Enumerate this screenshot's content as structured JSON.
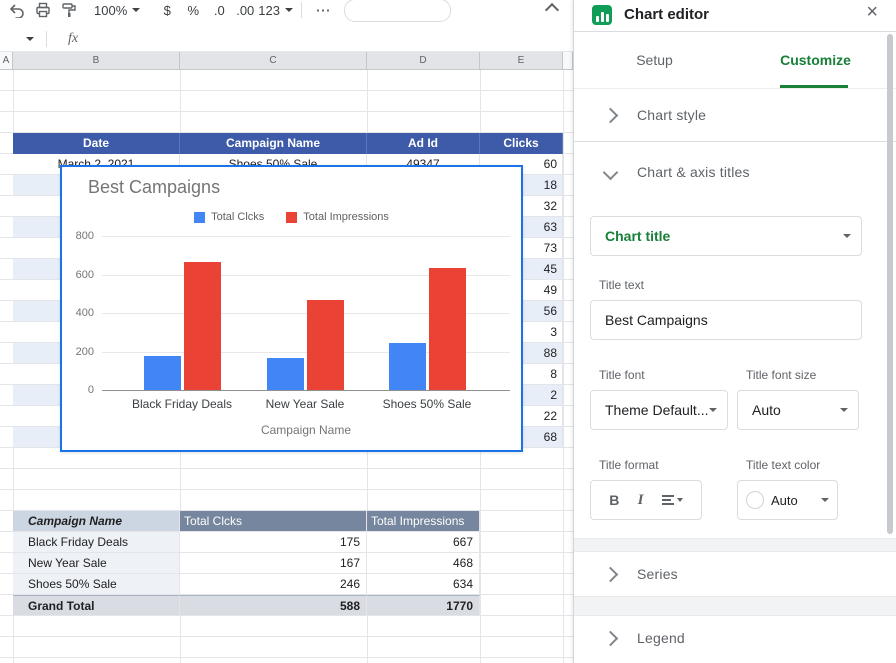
{
  "icons": {
    "close": "×",
    "overflow": "⋯"
  },
  "toolbar": {
    "zoom": "100%",
    "currency": "$",
    "percent": "%",
    "decimal_decrease": ".0",
    "decimal_increase": ".00",
    "more_formats": "123",
    "fx": "fx"
  },
  "grid": {
    "column_headers": [
      "A",
      "B",
      "C",
      "D",
      "E"
    ],
    "data_table": {
      "headers": [
        "Date",
        "Campaign Name",
        "Ad Id",
        "Clicks"
      ],
      "rows": [
        [
          "March 2, 2021",
          "Shoes 50% Sale",
          "49347",
          "60"
        ],
        [
          "",
          "",
          "",
          "18"
        ],
        [
          "",
          "",
          "",
          "32"
        ],
        [
          "",
          "",
          "",
          "63"
        ],
        [
          "",
          "",
          "",
          "73"
        ],
        [
          "",
          "",
          "",
          "45"
        ],
        [
          "",
          "",
          "",
          "49"
        ],
        [
          "",
          "",
          "",
          "56"
        ],
        [
          "",
          "",
          "",
          "3"
        ],
        [
          "",
          "",
          "",
          "88"
        ],
        [
          "",
          "",
          "",
          "8"
        ],
        [
          "",
          "",
          "",
          "2"
        ],
        [
          "",
          "",
          "",
          "22"
        ],
        [
          "",
          "",
          "",
          "68"
        ]
      ]
    },
    "summary_table": {
      "headers": [
        "Campaign Name",
        "Total Clcks",
        "Total Impressions"
      ],
      "rows": [
        [
          "Black Friday Deals",
          "175",
          "667"
        ],
        [
          "New Year Sale",
          "167",
          "468"
        ],
        [
          "Shoes 50% Sale",
          "246",
          "634"
        ]
      ],
      "total_row": [
        "Grand Total",
        "588",
        "1770"
      ]
    }
  },
  "chart_data": {
    "type": "bar",
    "title": "Best Campaigns",
    "categories": [
      "Black Friday Deals",
      "New Year Sale",
      "Shoes 50% Sale"
    ],
    "series": [
      {
        "name": "Total Clcks",
        "color": "#4285f4",
        "values": [
          175,
          167,
          246
        ]
      },
      {
        "name": "Total Impressions",
        "color": "#ea4335",
        "values": [
          667,
          468,
          634
        ]
      }
    ],
    "xlabel": "Campaign Name",
    "ylabel": "",
    "ylim": [
      0,
      800
    ],
    "yticks": [
      0,
      200,
      400,
      600,
      800
    ],
    "legend_position": "top",
    "grid": true
  },
  "chart_editor": {
    "title": "Chart editor",
    "tabs": {
      "setup": "Setup",
      "customize": "Customize"
    },
    "sections": {
      "chart_style": "Chart style",
      "chart_axis_titles": "Chart & axis titles",
      "series": "Series",
      "legend": "Legend"
    },
    "chart_title_dropdown": "Chart title",
    "title_text": {
      "label": "Title text",
      "value": "Best Campaigns"
    },
    "title_font": {
      "label": "Title font",
      "value": "Theme Default..."
    },
    "title_font_size": {
      "label": "Title font size",
      "value": "Auto"
    },
    "title_format": {
      "label": "Title format",
      "bold": "B",
      "italic": "I"
    },
    "title_text_color": {
      "label": "Title text color",
      "value": "Auto"
    }
  },
  "colors": {
    "accent_selection": "#1a73e8",
    "active_tab_green": "#188038",
    "table_header_blue": "#3d5ba8",
    "series_clicks": "#4285f4",
    "series_impressions": "#ea4335"
  }
}
